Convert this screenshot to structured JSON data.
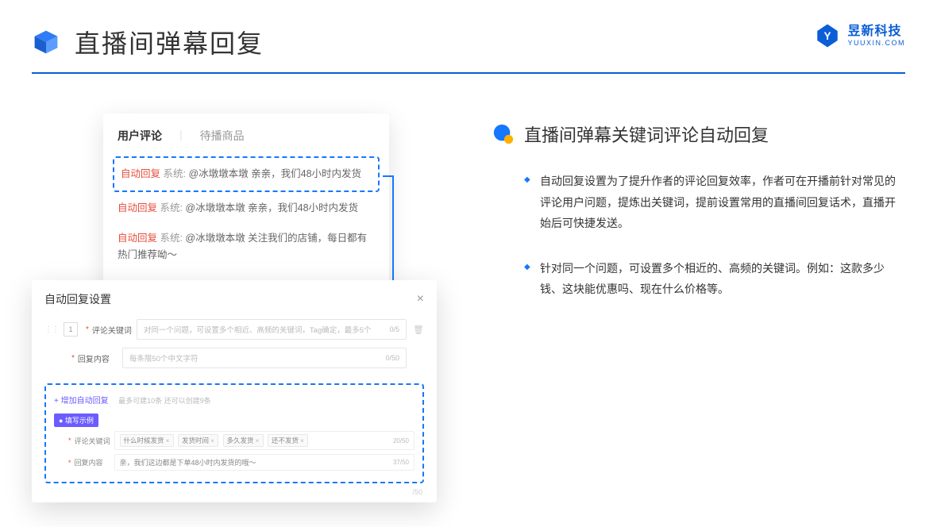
{
  "header": {
    "title": "直播间弹幕回复"
  },
  "brand": {
    "cn": "昱新科技",
    "en": "YUUXIN.COM"
  },
  "commentPanel": {
    "tabs": {
      "active": "用户评论",
      "inactive": "待播商品"
    },
    "items": [
      {
        "tag": "自动回复",
        "sys": "系统:",
        "at": "@冰墩墩本墩",
        "text": " 亲亲，我们48小时内发货"
      },
      {
        "tag": "自动回复",
        "sys": "系统:",
        "at": "@冰墩墩本墩",
        "text": " 亲亲，我们48小时内发货"
      },
      {
        "tag": "自动回复",
        "sys": "系统:",
        "at": "@冰墩墩本墩",
        "text": " 关注我们的店铺，每日都有热门推荐呦～"
      }
    ]
  },
  "dialog": {
    "title": "自动回复设置",
    "rowNum": "1",
    "keywordLabel": "评论关键词",
    "keywordPlaceholder": "对同一个问题，可设置多个相近、高频的关键词，Tag确定，最多5个",
    "keywordCounter": "0/5",
    "replyLabel": "回复内容",
    "replyPlaceholder": "每条限50个中文字符",
    "replyCounter": "0/50",
    "addLink": "+ 增加自动回复",
    "addHint": "最多可建10条 还可以创建9条",
    "badge": "● 填写示例",
    "exKeywordLabel": "评论关键词",
    "exTags": [
      "什么时候发货",
      "发货时间",
      "多久发货",
      "还不发货"
    ],
    "exKeywordCounter": "20/50",
    "exReplyLabel": "回复内容",
    "exReplyText": "亲，我们这边都是下单48小时内发货的哦～",
    "exReplyCounter": "37/50",
    "ghostCounter": "/50"
  },
  "section": {
    "title": "直播间弹幕关键词评论自动回复",
    "bullets": [
      "自动回复设置为了提升作者的评论回复效率，作者可在开播前针对常见的评论用户问题，提炼出关键词，提前设置常用的直播间回复话术，直播开始后可快捷发送。",
      "针对同一个问题，可设置多个相近的、高频的关键词。例如：这款多少钱、这块能优惠吗、现在什么价格等。"
    ]
  }
}
